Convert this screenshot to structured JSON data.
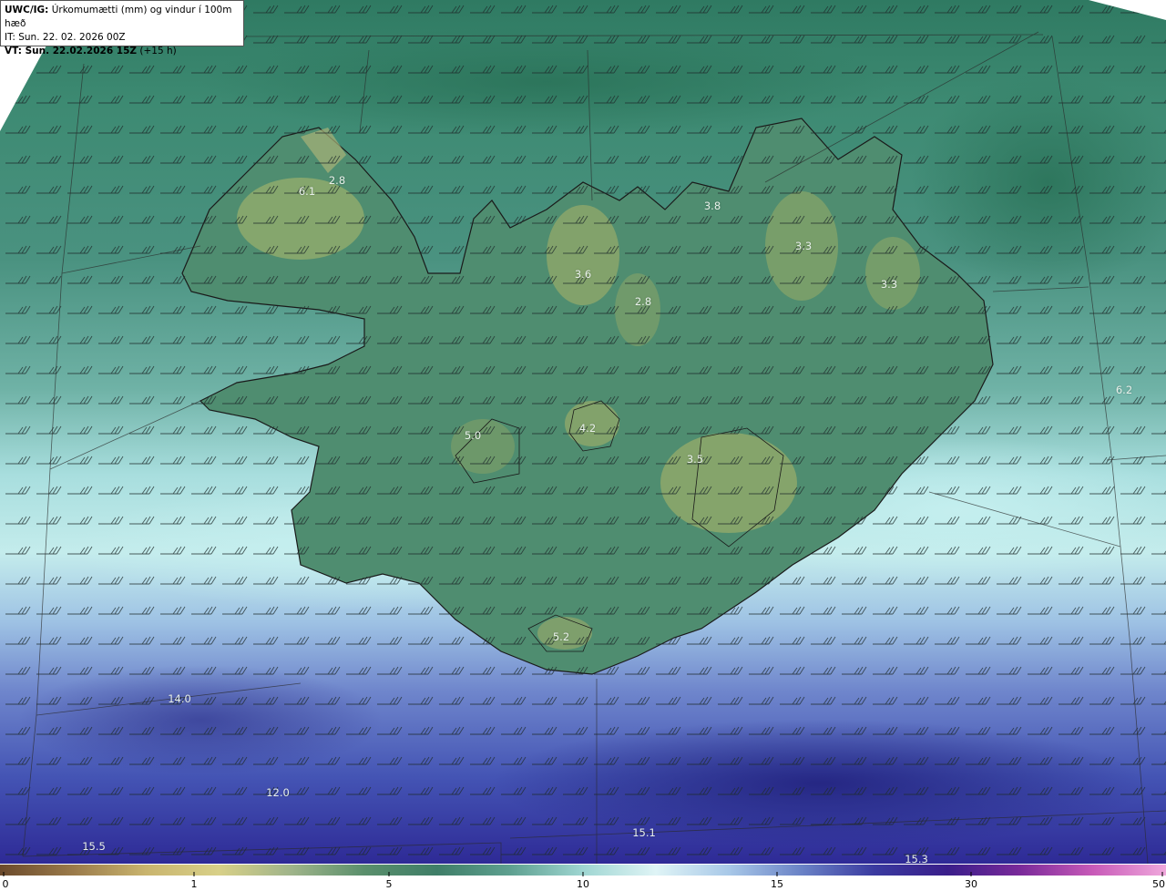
{
  "title": {
    "model_label": "UWC/IG:",
    "description": "Úrkomumætti (mm) og vindur í 100m hæð",
    "it_line": "IT: Sun. 22. 02. 2026 00Z",
    "vt_label": "VT: Sun. 22.02.2026 15Z",
    "vt_offset": "(+15 h)"
  },
  "value_labels": [
    "2.8",
    "6.1",
    "3.8",
    "3.3",
    "3.3",
    "3.6",
    "2.8",
    "4.2",
    "5.0",
    "3.5",
    "6.2",
    "5.2",
    "14.0",
    "12.0",
    "15.5",
    "15.1",
    "15.3"
  ],
  "colorbar": {
    "tick_labels": [
      "0",
      "1",
      "5",
      "10",
      "15",
      "30",
      "50"
    ],
    "colors": [
      "#6b4a2c",
      "#9a7a4a",
      "#c9b46e",
      "#d8d088",
      "#9fb48a",
      "#5a8f6c",
      "#3f7e68",
      "#5ea090",
      "#9fd6d2",
      "#dff4f6",
      "#a8c8e8",
      "#6a82c6",
      "#3a3aa0",
      "#3a1e8a",
      "#7a2a9a",
      "#c85ab8",
      "#f0a8dc"
    ]
  },
  "colors": {
    "sea_green": "#3f7e6a",
    "land_olive": "#8ea66a",
    "light_cyan": "#c8eeee",
    "blue": "#4c5cb8",
    "dark_blue": "#2a2a8c"
  }
}
